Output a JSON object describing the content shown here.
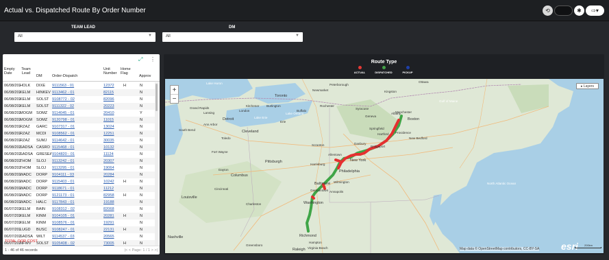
{
  "header": {
    "title": "Actual vs. Dispatched Route By Order Number"
  },
  "filters": {
    "team_lead": {
      "label": "TEAM LEAD",
      "value": "All"
    },
    "dm": {
      "label": "DM",
      "value": "All"
    }
  },
  "table": {
    "columns": [
      "Empty Date",
      "Team Lead",
      "DM",
      "Order-Dispatch",
      "Unit Number",
      "Home Flag",
      "Approv"
    ],
    "rows": [
      [
        "06/08/2022",
        "HOLK",
        "DIXE",
        "9111563 - 01",
        "12372",
        "H",
        "N"
      ],
      [
        "06/08/2022",
        "KELM",
        "HINKEV",
        "9113462 - 01",
        "82115",
        "",
        "N"
      ],
      [
        "06/08/2022",
        "KELM",
        "SOLST",
        "9108772 - 02",
        "82096",
        "",
        "N"
      ],
      [
        "06/08/2022",
        "KELM",
        "SOLST",
        "9111322 - 02",
        "20223",
        "",
        "N"
      ],
      [
        "06/08/2022",
        "MOGM",
        "SOMZ",
        "9114045 - 01",
        "20410",
        "",
        "Y"
      ],
      [
        "06/08/2022",
        "MOGM",
        "SOMZ",
        "9120798 - 01",
        "11015",
        "",
        "N"
      ],
      [
        "06/08/2022",
        "RZAZ",
        "GARC",
        "9107317 - 01",
        "13024",
        "",
        "N"
      ],
      [
        "06/08/2022",
        "RZAZ",
        "MCDI",
        "9108562 - 01",
        "12251",
        "",
        "N"
      ],
      [
        "06/08/2022",
        "RZAZ",
        "SUMJ",
        "9114642 - 01",
        "30035",
        "",
        "N"
      ],
      [
        "06/08/2022",
        "SADSA",
        "CASRO",
        "9115468 - 01",
        "10132",
        "",
        "N"
      ],
      [
        "06/08/2022",
        "SADSA",
        "GRESEA",
        "9104820 - 01",
        "11124",
        "",
        "N"
      ],
      [
        "06/08/2022",
        "THOM",
        "SLOJ",
        "9113242 - 01",
        "20307",
        "",
        "N"
      ],
      [
        "06/08/2022",
        "THOM",
        "SLOJ",
        "9113295 - 01",
        "19064",
        "",
        "N"
      ],
      [
        "06/08/2022",
        "WADC",
        "DORP",
        "9104111 - 03",
        "20284",
        "",
        "N"
      ],
      [
        "06/08/2022",
        "WADC",
        "DORP",
        "9115403 - 01",
        "10242",
        "H",
        "N"
      ],
      [
        "06/08/2022",
        "WADC",
        "DORP",
        "9118671 - 01",
        "11212",
        "",
        "N"
      ],
      [
        "06/08/2022",
        "WADC",
        "DORP",
        "9121173 - 01",
        "82958",
        "H",
        "N"
      ],
      [
        "06/08/2022",
        "WADC",
        "HALC",
        "9117843 - 01",
        "19188",
        "",
        "N"
      ],
      [
        "06/07/2022",
        "KELM",
        "BAIN",
        "9108312 - 02",
        "82068",
        "",
        "N"
      ],
      [
        "06/07/2022",
        "KELM",
        "KINM",
        "9104105 - 01",
        "20281",
        "H",
        "N"
      ],
      [
        "06/07/2022",
        "KELM",
        "KINM",
        "9108576 - 01",
        "19291",
        "",
        "N"
      ],
      [
        "06/07/2022",
        "LUGD",
        "BUSC",
        "9108247 - 01",
        "22131",
        "H",
        "N"
      ],
      [
        "06/07/2022",
        "SADSA",
        "WILT",
        "9114537 - 03",
        "20565",
        "",
        "N"
      ],
      [
        "06/07/2022",
        "NFWV",
        "SOLST",
        "9105408 - 02",
        "73005",
        "H",
        "N"
      ]
    ],
    "total_label": "TOTAL OOR COST",
    "records": "1 - 46 of 46 records",
    "pager": "|<  <  Page: 1 / 1  >  >|",
    "expand_icon": "expand-icon",
    "menu_icon": "more-vertical-icon"
  },
  "map": {
    "title": "Route Type",
    "legend": [
      {
        "label": "ACTUAL",
        "color": "#e53935"
      },
      {
        "label": "DISPATCHED",
        "color": "#43a047"
      },
      {
        "label": "PICKUP",
        "color": "#1e3fa8"
      }
    ],
    "zoom_in": "+",
    "zoom_out": "−",
    "layers_button": "▸ Layers",
    "attribution": "Map data © OpenStreetMap contributors, CC-BY-SA",
    "esri_logo": "esri",
    "scale": "200km",
    "place_labels": {
      "peterborough": "Peterborough",
      "newmarket": "Newmarket",
      "kingston": "Kingston",
      "toronto": "Toronto",
      "ottawa": "Ottawa",
      "kitchener": "Kitchener",
      "burlington": "Burlington",
      "rochester": "Rochester",
      "syracuse": "Syracuse",
      "albany": "Albany",
      "manchester": "Manchester",
      "boston": "Boston",
      "grand_rapids": "Grand Rapids",
      "lansing": "Lansing",
      "detroit": "Detroit",
      "ann_arbor": "Ann Arbor",
      "london": "London",
      "erie": "Erie",
      "buffalo": "Buffalo",
      "geneva": "Geneva",
      "springfield": "Springfield",
      "hartford": "Hartford",
      "providence": "Providence",
      "new_bedford": "New Bedford",
      "south_bend": "South Bend",
      "toledo": "Toledo",
      "cleveland": "Cleveland",
      "scranton": "Scranton",
      "danbury": "Danbury",
      "bridgeport": "Bridgeport",
      "new_york": "New York",
      "fort_wayne": "Fort Wayne",
      "pittsburgh": "Pittsburgh",
      "harrisburg": "Harrisburg",
      "allentown": "Allentown",
      "philadelphia": "Philadelphia",
      "dayton": "Dayton",
      "columbus": "Columbus",
      "wilmington": "Wilmington",
      "germantown": "Germantown",
      "baltimore": "Baltimore",
      "annapolis": "Annapolis",
      "washington": "Washington",
      "cincinnati": "Cincinnati",
      "louisville": "Louisville",
      "charleston": "Charleston",
      "richmond": "Richmond",
      "hampton": "Hampton",
      "virginia_beach": "Virginia Beach",
      "nashville": "Nashville",
      "greensboro": "Greensboro",
      "raleigh": "Raleigh",
      "lake_huron": "Lake Huron",
      "lake_ontario": "Lake Ontario",
      "lake_erie": "Lake Erie",
      "gulf_of_maine": "Gulf of Maine",
      "atlantic": "North Atlantic Ocean"
    }
  }
}
